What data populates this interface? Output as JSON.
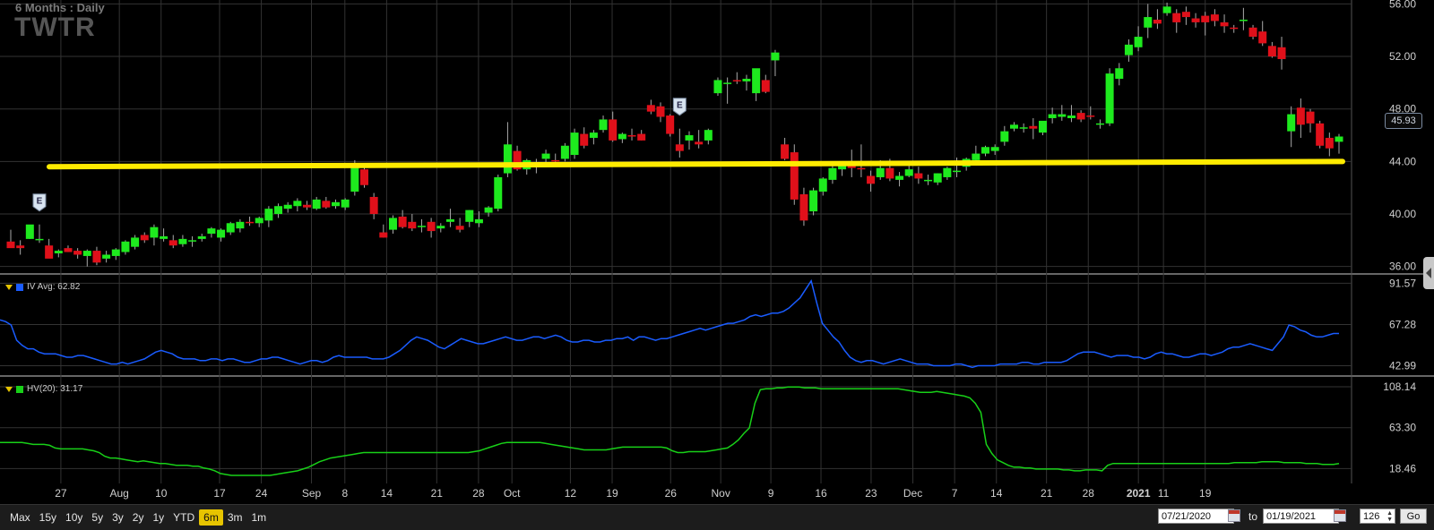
{
  "header": {
    "period": "6 Months : Daily",
    "symbol": "TWTR"
  },
  "colors": {
    "up": "#1eea1e",
    "down": "#e0101a",
    "iv": "#1a5cff",
    "hv": "#18d018",
    "trendline": "#ffeb00",
    "grid": "#333333",
    "active_range": "#e6c400"
  },
  "chart_data": [
    {
      "type": "candlestick",
      "x_tick_labels": [
        "27",
        "Aug",
        "10",
        "17",
        "24",
        "Sep",
        "8",
        "14",
        "21",
        "28",
        "Oct",
        "12",
        "19",
        "26",
        "Nov",
        "9",
        "16",
        "23",
        "Dec",
        "7",
        "14",
        "21",
        "28",
        "2021",
        "11",
        "19"
      ],
      "y_tick_labels": [
        "36.00",
        "40.00",
        "44.00",
        "48.00",
        "52.00",
        "56.00"
      ],
      "ylim": [
        35.5,
        56.3
      ],
      "last_price": "45.93",
      "earnings_markers": [
        {
          "label": "E",
          "index": 3
        },
        {
          "label": "E",
          "index": 70
        }
      ],
      "trendline": {
        "from": [
          0,
          43.6
        ],
        "to": [
          125,
          44.0
        ]
      },
      "ohlc": [
        [
          37.9,
          38.8,
          37.5,
          37.4
        ],
        [
          37.6,
          38.0,
          36.9,
          37.4
        ],
        [
          38.1,
          38.8,
          38.1,
          39.2
        ],
        [
          38.0,
          39.2,
          37.8,
          38.1
        ],
        [
          37.6,
          38.1,
          37.4,
          36.6
        ],
        [
          37.0,
          37.3,
          36.7,
          37.2
        ],
        [
          37.4,
          37.6,
          37.1,
          37.1
        ],
        [
          37.2,
          37.4,
          36.6,
          36.9
        ],
        [
          36.8,
          37.3,
          36.0,
          37.2
        ],
        [
          37.2,
          37.5,
          36.1,
          36.3
        ],
        [
          36.6,
          37.2,
          36.3,
          36.9
        ],
        [
          36.8,
          37.4,
          36.5,
          37.3
        ],
        [
          37.1,
          38.0,
          36.9,
          37.9
        ],
        [
          37.5,
          38.4,
          37.3,
          38.2
        ],
        [
          38.4,
          38.6,
          37.8,
          38.0
        ],
        [
          38.2,
          39.2,
          37.6,
          39.0
        ],
        [
          38.1,
          38.9,
          37.9,
          38.3
        ],
        [
          38.0,
          38.4,
          37.4,
          37.6
        ],
        [
          37.7,
          38.4,
          37.5,
          38.1
        ],
        [
          37.9,
          38.3,
          37.5,
          38.0
        ],
        [
          38.1,
          38.5,
          37.9,
          38.3
        ],
        [
          38.5,
          39.0,
          38.2,
          38.9
        ],
        [
          38.2,
          38.9,
          37.9,
          38.8
        ],
        [
          38.6,
          39.4,
          38.4,
          39.3
        ],
        [
          38.9,
          39.6,
          38.6,
          39.4
        ],
        [
          39.4,
          39.8,
          39.1,
          39.3
        ],
        [
          39.3,
          39.8,
          39.0,
          39.7
        ],
        [
          39.5,
          40.6,
          39.0,
          40.4
        ],
        [
          40.0,
          40.8,
          39.7,
          40.6
        ],
        [
          40.4,
          40.9,
          40.1,
          40.7
        ],
        [
          40.6,
          41.2,
          40.2,
          41.0
        ],
        [
          40.7,
          41.0,
          40.3,
          40.5
        ],
        [
          40.4,
          41.3,
          40.3,
          41.1
        ],
        [
          41.0,
          41.3,
          40.4,
          40.5
        ],
        [
          40.6,
          41.1,
          40.4,
          40.9
        ],
        [
          40.5,
          41.2,
          40.3,
          41.1
        ],
        [
          41.7,
          44.1,
          41.4,
          43.8
        ],
        [
          43.4,
          43.6,
          42.0,
          42.2
        ],
        [
          41.3,
          41.6,
          39.6,
          40.0
        ],
        [
          38.6,
          39.2,
          38.2,
          38.2
        ],
        [
          38.8,
          39.9,
          38.5,
          39.7
        ],
        [
          39.8,
          40.3,
          38.9,
          39.0
        ],
        [
          39.4,
          40.0,
          38.7,
          38.9
        ],
        [
          39.0,
          39.6,
          38.6,
          39.1
        ],
        [
          39.4,
          39.7,
          38.2,
          38.7
        ],
        [
          38.9,
          39.3,
          38.6,
          39.1
        ],
        [
          39.4,
          40.4,
          39.0,
          39.6
        ],
        [
          39.1,
          39.7,
          38.6,
          38.8
        ],
        [
          39.4,
          40.3,
          39.0,
          40.3
        ],
        [
          39.3,
          40.2,
          39.0,
          39.6
        ],
        [
          40.1,
          40.6,
          39.8,
          40.5
        ],
        [
          40.4,
          43.0,
          40.2,
          42.8
        ],
        [
          43.1,
          47.0,
          42.8,
          45.3
        ],
        [
          44.8,
          45.2,
          43.3,
          43.4
        ],
        [
          43.4,
          44.2,
          43.0,
          44.1
        ],
        [
          43.6,
          44.2,
          43.1,
          43.8
        ],
        [
          44.2,
          44.9,
          43.8,
          44.6
        ],
        [
          44.1,
          44.6,
          43.7,
          44.0
        ],
        [
          44.2,
          45.4,
          44.0,
          45.2
        ],
        [
          44.5,
          46.5,
          44.2,
          46.2
        ],
        [
          46.1,
          46.6,
          45.0,
          45.2
        ],
        [
          45.8,
          46.4,
          45.3,
          46.2
        ],
        [
          46.4,
          47.5,
          46.2,
          47.2
        ],
        [
          47.2,
          47.8,
          45.5,
          45.6
        ],
        [
          45.7,
          46.2,
          45.4,
          46.1
        ],
        [
          46.0,
          46.5,
          45.6,
          45.9
        ],
        [
          46.1,
          46.4,
          45.6,
          45.6
        ],
        [
          48.3,
          48.7,
          47.6,
          47.8
        ],
        [
          48.2,
          48.5,
          47.0,
          47.4
        ],
        [
          47.5,
          47.6,
          45.9,
          46.1
        ],
        [
          45.3,
          46.5,
          44.3,
          44.8
        ],
        [
          45.6,
          46.3,
          44.9,
          46.0
        ],
        [
          45.5,
          46.4,
          45.0,
          45.3
        ],
        [
          45.6,
          46.5,
          45.3,
          46.4
        ],
        [
          49.2,
          50.4,
          49.0,
          50.2
        ],
        [
          50.0,
          50.4,
          48.4,
          50.0
        ],
        [
          50.2,
          50.8,
          49.9,
          50.1
        ],
        [
          50.1,
          50.6,
          49.4,
          50.3
        ],
        [
          49.2,
          50.7,
          48.6,
          51.1
        ],
        [
          50.2,
          50.6,
          49.2,
          49.3
        ],
        [
          51.7,
          52.5,
          50.5,
          52.3
        ],
        [
          45.3,
          45.8,
          44.1,
          44.2
        ],
        [
          44.7,
          45.3,
          40.7,
          41.1
        ],
        [
          41.5,
          42.0,
          39.1,
          39.5
        ],
        [
          40.2,
          42.0,
          39.9,
          41.8
        ],
        [
          41.7,
          42.8,
          41.4,
          42.7
        ],
        [
          42.6,
          43.7,
          42.3,
          43.5
        ],
        [
          43.4,
          44.0,
          42.9,
          43.9
        ],
        [
          43.7,
          44.9,
          42.8,
          43.5
        ],
        [
          43.5,
          45.3,
          42.8,
          43.4
        ],
        [
          42.9,
          43.3,
          41.7,
          42.3
        ],
        [
          42.8,
          44.1,
          42.6,
          43.5
        ],
        [
          43.5,
          44.2,
          42.5,
          42.7
        ],
        [
          42.6,
          43.2,
          42.1,
          42.9
        ],
        [
          42.9,
          43.7,
          42.8,
          43.4
        ],
        [
          43.1,
          43.6,
          42.3,
          42.7
        ],
        [
          42.6,
          43.0,
          42.2,
          42.6
        ],
        [
          42.4,
          43.1,
          42.2,
          43.1
        ],
        [
          42.8,
          43.6,
          42.6,
          43.5
        ],
        [
          43.3,
          44.3,
          42.8,
          43.3
        ],
        [
          43.6,
          44.3,
          43.3,
          44.2
        ],
        [
          44.1,
          45.2,
          43.8,
          44.6
        ],
        [
          44.6,
          45.2,
          44.4,
          45.1
        ],
        [
          44.8,
          45.3,
          44.5,
          45.1
        ],
        [
          45.5,
          46.7,
          45.2,
          46.3
        ],
        [
          46.5,
          47.0,
          46.3,
          46.8
        ],
        [
          46.5,
          46.9,
          46.2,
          46.6
        ],
        [
          46.7,
          47.3,
          45.7,
          46.5
        ],
        [
          46.2,
          47.0,
          46.0,
          47.1
        ],
        [
          47.3,
          48.1,
          46.9,
          47.6
        ],
        [
          47.4,
          48.3,
          47.1,
          47.6
        ],
        [
          47.3,
          48.3,
          47.0,
          47.5
        ],
        [
          47.7,
          47.9,
          47.0,
          47.2
        ],
        [
          47.5,
          48.2,
          47.2,
          47.4
        ],
        [
          46.8,
          47.2,
          46.5,
          46.9
        ],
        [
          46.9,
          51.1,
          46.7,
          50.7
        ],
        [
          50.3,
          51.5,
          49.8,
          51.1
        ],
        [
          52.1,
          53.3,
          51.6,
          52.9
        ],
        [
          52.7,
          54.3,
          52.4,
          53.5
        ],
        [
          54.2,
          56.0,
          53.4,
          55.0
        ],
        [
          54.8,
          55.6,
          54.1,
          54.5
        ],
        [
          55.3,
          56.1,
          55.1,
          55.8
        ],
        [
          55.3,
          55.6,
          53.8,
          54.6
        ],
        [
          55.4,
          55.8,
          54.4,
          55.0
        ],
        [
          54.9,
          55.3,
          54.2,
          54.6
        ],
        [
          55.1,
          55.4,
          53.6,
          54.6
        ],
        [
          55.2,
          55.6,
          54.3,
          54.7
        ],
        [
          54.6,
          55.2,
          53.8,
          54.3
        ],
        [
          54.2,
          54.4,
          53.8,
          54.1
        ],
        [
          54.7,
          55.7,
          54.0,
          54.8
        ],
        [
          54.2,
          54.4,
          53.3,
          53.5
        ],
        [
          53.9,
          54.7,
          52.8,
          53.0
        ],
        [
          52.8,
          53.1,
          51.9,
          52.0
        ],
        [
          52.7,
          53.5,
          51.0,
          51.8
        ],
        [
          46.3,
          48.2,
          45.1,
          47.6
        ],
        [
          48.1,
          48.8,
          45.8,
          46.8
        ],
        [
          47.8,
          48.0,
          46.2,
          46.9
        ],
        [
          46.9,
          47.1,
          45.0,
          45.2
        ],
        [
          45.8,
          46.2,
          44.4,
          45.0
        ],
        [
          45.5,
          46.1,
          44.6,
          45.9
        ]
      ]
    },
    {
      "type": "line",
      "legend": "IV Avg: 62.82",
      "y_tick_labels": [
        "91.57",
        "67.28",
        "42.99"
      ],
      "ylim": [
        38,
        96
      ],
      "values": [
        70,
        69,
        67,
        58,
        55,
        53,
        53,
        51,
        50,
        50,
        50,
        49,
        48,
        48,
        49,
        49,
        48,
        47,
        46,
        45,
        44,
        44,
        45,
        44,
        45,
        46,
        47,
        49,
        51,
        52,
        51,
        50,
        48,
        47,
        47,
        47,
        46,
        46,
        47,
        47,
        46,
        47,
        47,
        46,
        45,
        45,
        46,
        47,
        47,
        48,
        48,
        47,
        46,
        45,
        44,
        45,
        46,
        46,
        45,
        46,
        48,
        49,
        48,
        48,
        48,
        48,
        48,
        47,
        47,
        47,
        48,
        50,
        52,
        55,
        58,
        60,
        59,
        58,
        56,
        54,
        53,
        55,
        57,
        59,
        58,
        57,
        56,
        56,
        57,
        58,
        59,
        60,
        59,
        58,
        58,
        59,
        60,
        60,
        59,
        60,
        61,
        60,
        58,
        57,
        57,
        58,
        58,
        57,
        57,
        58,
        58,
        59,
        59,
        60,
        58,
        60,
        60,
        59,
        58,
        59,
        59,
        60,
        61,
        62,
        63,
        64,
        65,
        64,
        65,
        66,
        67,
        68,
        68,
        69,
        70,
        72,
        73,
        72,
        73,
        74,
        74,
        75,
        77,
        80,
        83,
        88,
        93,
        80,
        68,
        64,
        60,
        57,
        52,
        48,
        46,
        45,
        46,
        46,
        45,
        44,
        45,
        46,
        47,
        46,
        45,
        44,
        44,
        44,
        43,
        43,
        43,
        43,
        44,
        44,
        43,
        42,
        43,
        43,
        43,
        43,
        44,
        44,
        44,
        44,
        45,
        45,
        44,
        44,
        45,
        45,
        45,
        45,
        46,
        48,
        50,
        51,
        51,
        51,
        50,
        49,
        48,
        49,
        49,
        49,
        48,
        48,
        47,
        48,
        50,
        51,
        50,
        50,
        49,
        48,
        48,
        49,
        50,
        50,
        49,
        50,
        51,
        53,
        54,
        54,
        55,
        56,
        55,
        54,
        53,
        52,
        56,
        60,
        67,
        66,
        64,
        63,
        61,
        60,
        60,
        61,
        62,
        62
      ]
    },
    {
      "type": "line",
      "legend": "HV(20): 31.17",
      "y_tick_labels": [
        "108.14",
        "63.30",
        "18.46"
      ],
      "ylim": [
        10,
        118
      ],
      "values": [
        47,
        47,
        47,
        47,
        47,
        46,
        45,
        45,
        45,
        44,
        41,
        40,
        40,
        40,
        40,
        40,
        39,
        38,
        36,
        32,
        30,
        30,
        29,
        28,
        27,
        26,
        27,
        26,
        25,
        24,
        24,
        23,
        22,
        22,
        22,
        21,
        21,
        19,
        18,
        16,
        13,
        12,
        11,
        11,
        11,
        11,
        11,
        11,
        11,
        11,
        12,
        13,
        14,
        15,
        16,
        18,
        20,
        23,
        26,
        28,
        30,
        31,
        32,
        33,
        34,
        35,
        36,
        36,
        36,
        36,
        36,
        36,
        36,
        36,
        36,
        36,
        36,
        36,
        36,
        36,
        36,
        36,
        36,
        36,
        36,
        36,
        37,
        38,
        40,
        42,
        44,
        46,
        47,
        47,
        47,
        47,
        47,
        47,
        47,
        46,
        45,
        44,
        43,
        42,
        41,
        40,
        39,
        39,
        39,
        39,
        39,
        40,
        41,
        42,
        42,
        42,
        42,
        42,
        42,
        42,
        42,
        41,
        38,
        36,
        36,
        37,
        37,
        37,
        37,
        38,
        39,
        40,
        41,
        45,
        50,
        57,
        63,
        90,
        105,
        106,
        106,
        107,
        107,
        108,
        108,
        108,
        107,
        107,
        107,
        106,
        106,
        106,
        106,
        106,
        106,
        106,
        106,
        106,
        106,
        106,
        106,
        106,
        106,
        106,
        105,
        104,
        103,
        102,
        102,
        102,
        103,
        102,
        101,
        100,
        99,
        98,
        96,
        90,
        80,
        45,
        35,
        28,
        25,
        22,
        20,
        20,
        19,
        19,
        18,
        18,
        18,
        18,
        18,
        17,
        17,
        16,
        16,
        17,
        17,
        17,
        16,
        22,
        24,
        24,
        24,
        24,
        24,
        24,
        24,
        24,
        24,
        24,
        24,
        24,
        24,
        24,
        24,
        24,
        24,
        24,
        24,
        24,
        24,
        24,
        25,
        25,
        25,
        25,
        25,
        26,
        26,
        26,
        26,
        25,
        25,
        25,
        25,
        24,
        24,
        24,
        23,
        23,
        23,
        24
      ]
    }
  ],
  "toolbar": {
    "ranges": [
      "Max",
      "15y",
      "10y",
      "5y",
      "3y",
      "2y",
      "1y",
      "YTD",
      "6m",
      "3m",
      "1m"
    ],
    "active_range": "6m",
    "from_date": "07/21/2020",
    "to_label": "to",
    "to_date": "01/19/2021",
    "bars": "126",
    "go_label": "Go"
  }
}
